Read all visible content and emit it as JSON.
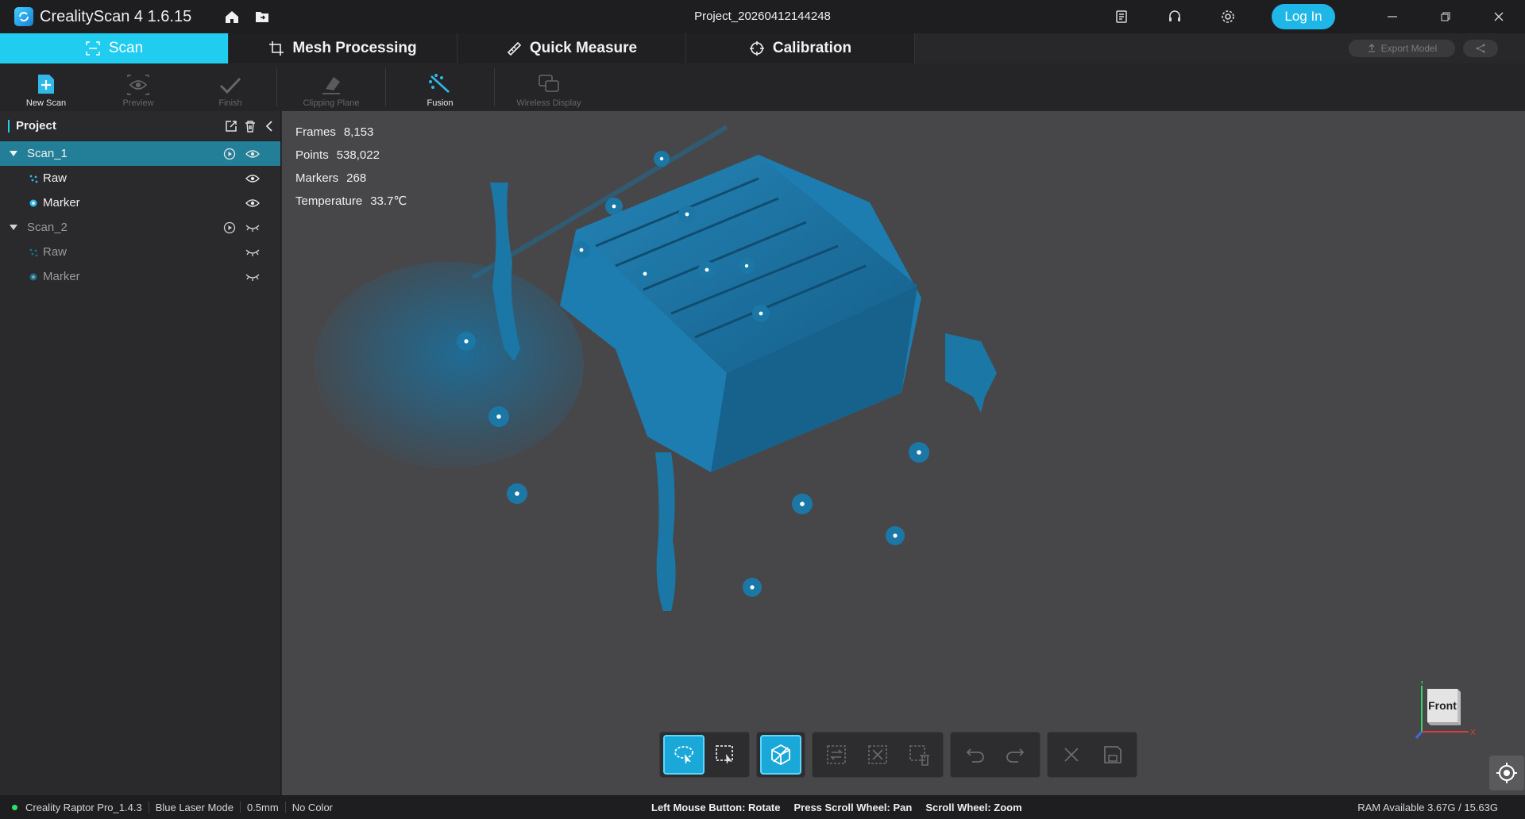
{
  "app": {
    "title": "CrealityScan 4 1.6.15",
    "project_name": "Project_20260412144248",
    "login_label": "Log In"
  },
  "modules": [
    {
      "label": "Scan",
      "active": true
    },
    {
      "label": "Mesh Processing"
    },
    {
      "label": "Quick Measure"
    },
    {
      "label": "Calibration"
    }
  ],
  "header_actions": {
    "export_label": "Export Model"
  },
  "toolbar": {
    "new_scan": "New Scan",
    "preview": "Preview",
    "finish": "Finish",
    "clipping_plane": "Clipping Plane",
    "fusion": "Fusion",
    "wireless_display": "Wireless Display"
  },
  "sidebar": {
    "title": "Project",
    "scans": [
      {
        "label": "Scan_1",
        "children": [
          {
            "label": "Raw"
          },
          {
            "label": "Marker"
          }
        ]
      },
      {
        "label": "Scan_2",
        "children": [
          {
            "label": "Raw"
          },
          {
            "label": "Marker"
          }
        ]
      }
    ]
  },
  "stats": [
    {
      "label": "Frames",
      "value": "8,153"
    },
    {
      "label": "Points",
      "value": "538,022"
    },
    {
      "label": "Markers",
      "value": "268"
    },
    {
      "label": "Temperature",
      "value": "33.7℃"
    }
  ],
  "axis": {
    "view_label": "Front",
    "x": "X",
    "y": "Y"
  },
  "colors": {
    "accent": "#20cdf0",
    "scan_blue": "#1b77a6",
    "login": "#1fb6e8"
  },
  "statusbar": {
    "device": "Creality Raptor Pro_1.4.3",
    "mode": "Blue Laser Mode",
    "resolution": "0.5mm",
    "color": "No Color",
    "hint_rotate": "Left Mouse Button: Rotate",
    "hint_pan": "Press Scroll Wheel: Pan",
    "hint_zoom": "Scroll Wheel: Zoom",
    "ram": "RAM Available 3.67G / 15.63G"
  }
}
